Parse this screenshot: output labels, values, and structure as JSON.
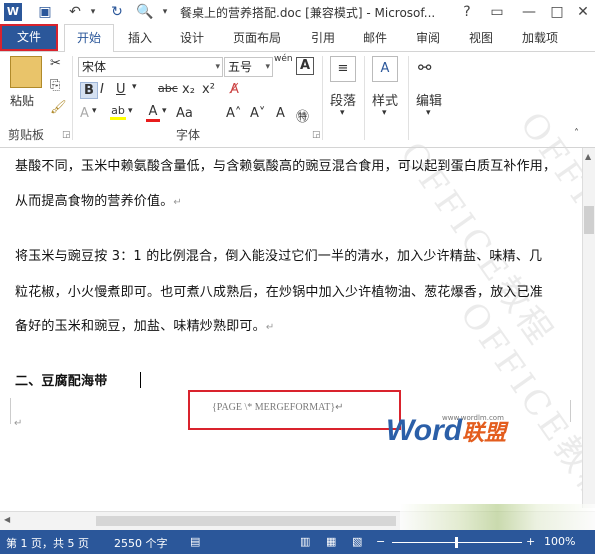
{
  "title": "餐桌上的营养搭配.doc [兼容模式] - Microsof...",
  "window_controls": {
    "help": "?",
    "restore": "▭",
    "minimize": "—",
    "maximize": "□",
    "close": "✕"
  },
  "tabs": [
    "文件",
    "开始",
    "插入",
    "设计",
    "页面布局",
    "引用",
    "邮件",
    "审阅",
    "视图",
    "加载项"
  ],
  "ribbon": {
    "clipboard": {
      "paste": "粘贴",
      "label": "剪贴板"
    },
    "font": {
      "name": "宋体",
      "size": "五号",
      "wen": "wén",
      "A_box": "A",
      "label": "字体"
    },
    "paragraph": {
      "label": "段落"
    },
    "styles": {
      "label": "样式"
    },
    "editing": {
      "label": "编辑"
    }
  },
  "document": {
    "p1": "基酸不同，玉米中赖氨酸含量低，与含赖氨酸高的豌豆混合食用，可以起到蛋白质互补作用，",
    "p2": "从而提高食物的营养价值。",
    "p3": "将玉米与豌豆按 3：1 的比例混合，倒入能没过它们一半的清水，加入少许精盐、味精、几",
    "p4": "粒花椒，小火慢煮即可。也可煮八成熟后，在炒锅中加入少许植物油、葱花爆香，放入已准",
    "p5": "备好的玉米和豌豆，加盐、味精炒熟即可。",
    "heading": "二、豆腐配海带",
    "field_code": "{PAGE    \\* MERGEFORMAT}",
    "para_mark": "↵"
  },
  "logo": {
    "word": "Word",
    "cn": "联盟",
    "url": "www.wordlm.com"
  },
  "watermark": "OFFICE教程",
  "status": {
    "page": "第 1 页，共 5 页",
    "words": "2550 个字",
    "zoom": "100%"
  }
}
